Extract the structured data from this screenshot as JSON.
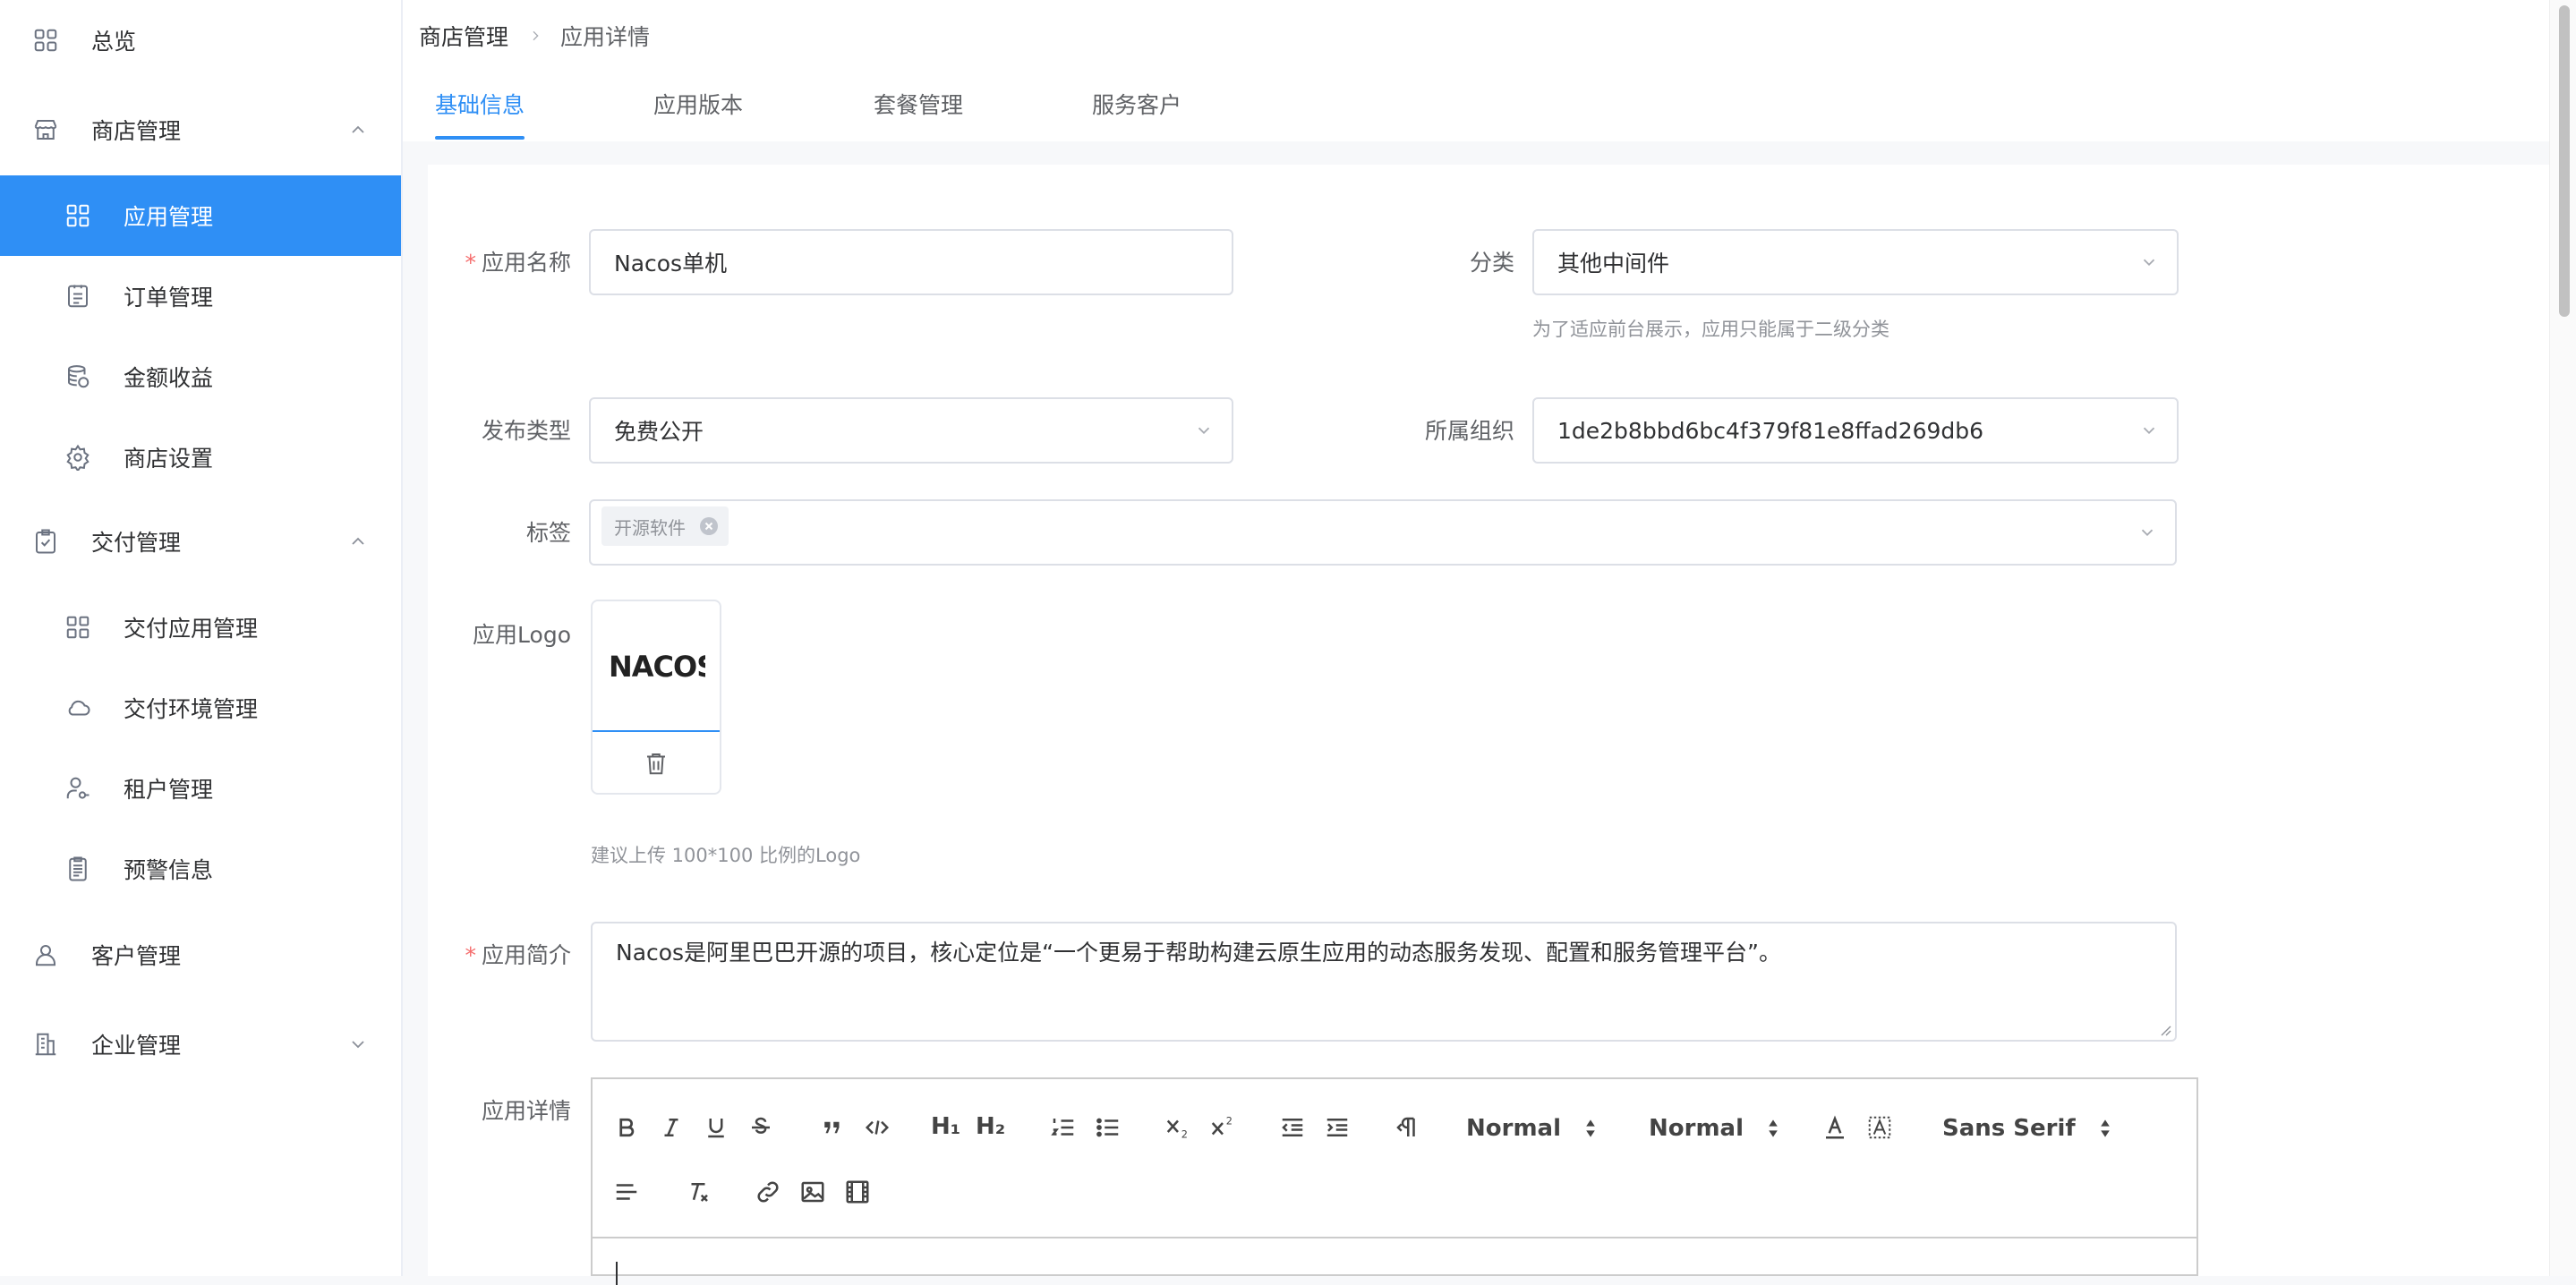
{
  "sidebar": {
    "items": [
      {
        "label": "总览",
        "icon": "grid-icon"
      },
      {
        "label": "商店管理",
        "icon": "shop-icon",
        "expanded": true
      },
      {
        "label": "应用管理",
        "icon": "apps-icon",
        "active": true
      },
      {
        "label": "订单管理",
        "icon": "order-icon"
      },
      {
        "label": "金额收益",
        "icon": "database-icon"
      },
      {
        "label": "商店设置",
        "icon": "gear-icon"
      },
      {
        "label": "交付管理",
        "icon": "clipboard-check-icon",
        "expanded": true
      },
      {
        "label": "交付应用管理",
        "icon": "apps-icon"
      },
      {
        "label": "交付环境管理",
        "icon": "cloud-icon"
      },
      {
        "label": "租户管理",
        "icon": "user-key-icon"
      },
      {
        "label": "预警信息",
        "icon": "alert-list-icon"
      },
      {
        "label": "客户管理",
        "icon": "user-icon"
      },
      {
        "label": "企业管理",
        "icon": "building-icon",
        "expanded": false
      }
    ]
  },
  "breadcrumb": {
    "first": "商店管理",
    "last": "应用详情"
  },
  "tabs": [
    {
      "label": "基础信息",
      "active": true
    },
    {
      "label": "应用版本"
    },
    {
      "label": "套餐管理"
    },
    {
      "label": "服务客户"
    }
  ],
  "form": {
    "app_name": {
      "label": "应用名称",
      "value": "Nacos单机",
      "required": true
    },
    "category": {
      "label": "分类",
      "value": "其他中间件",
      "hint": "为了适应前台展示，应用只能属于二级分类"
    },
    "publish_type": {
      "label": "发布类型",
      "value": "免费公开"
    },
    "org": {
      "label": "所属组织",
      "value": "1de2b8bbd6bc4f379f81e8ffad269db6"
    },
    "tags": {
      "label": "标签",
      "values": [
        "开源软件"
      ]
    },
    "logo": {
      "label": "应用Logo",
      "logo_text": "NACOS.",
      "hint": "建议上传 100*100 比例的Logo"
    },
    "intro": {
      "label": "应用简介",
      "required": true,
      "value": "Nacos是阿里巴巴开源的项目，核心定位是“一个更易于帮助构建云原生应用的动态服务发现、配置和服务管理平台”。"
    },
    "detail": {
      "label": "应用详情"
    }
  },
  "editor": {
    "header_picker": "Normal",
    "size_picker": "Normal",
    "font_picker": "Sans Serif",
    "h1": "H₁",
    "h2": "H₂"
  },
  "colors": {
    "accent": "#2f8ff5",
    "required": "#f56c6c"
  }
}
